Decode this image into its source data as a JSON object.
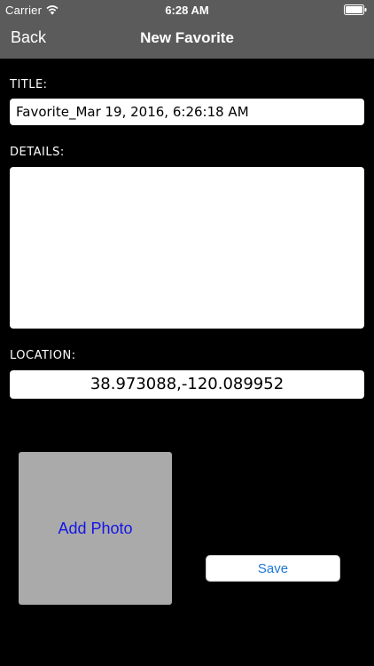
{
  "status_bar": {
    "carrier": "Carrier",
    "time": "6:28 AM",
    "wifi_icon": "wifi-icon",
    "battery_icon": "battery-icon"
  },
  "nav_bar": {
    "back_label": "Back",
    "title": "New Favorite"
  },
  "form": {
    "title_label": "TITLE:",
    "title_value": "Favorite_Mar 19, 2016, 6:26:18 AM",
    "details_label": "DETAILS:",
    "details_value": "",
    "location_label": "LOCATION:",
    "location_value": "38.973088,-120.089952"
  },
  "actions": {
    "add_photo_label": "Add Photo",
    "save_label": "Save"
  },
  "colors": {
    "background": "#000000",
    "nav_bar": "#5b5b5b",
    "photo_placeholder": "#aaaaaa",
    "add_photo_text": "#1515e6",
    "save_text": "#1d77d6"
  }
}
